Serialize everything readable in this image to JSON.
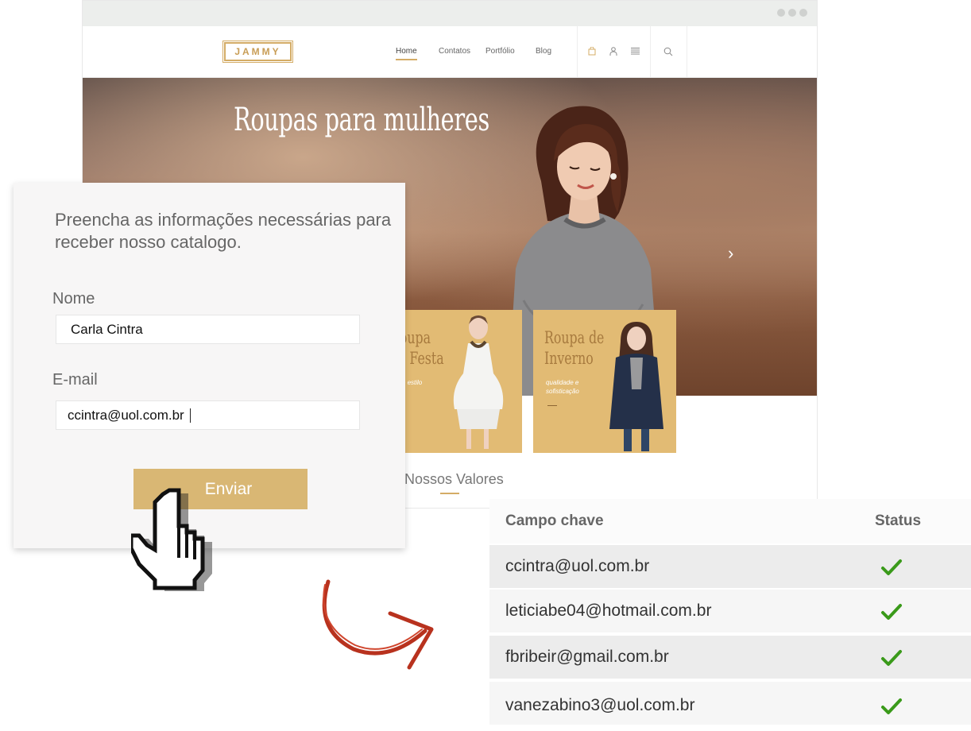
{
  "browser": {
    "logo": "JAMMY",
    "nav": [
      "Home",
      "Contatos",
      "Portfólio",
      "Blog"
    ],
    "icons": [
      "bag-icon",
      "user-icon",
      "menu-icon",
      "search-icon"
    ],
    "hero_title": "Roupas para mulheres",
    "promos": [
      {
        "title": "Roupa\nde Festa",
        "subtitle": "novo estilo\nsexy"
      },
      {
        "title": "Roupa de\nInverno",
        "subtitle": "qualidade e\nsofisticação"
      }
    ],
    "values_title": "Nossos Valores"
  },
  "form": {
    "intro": "Preencha as informações necessárias para receber nosso catalogo.",
    "name_label": "Nome",
    "name_value": "Carla Cintra",
    "email_label": "E-mail",
    "email_value": "ccintra@uol.com.br",
    "submit_label": "Enviar"
  },
  "table": {
    "headers": [
      "Campo chave",
      "Status"
    ],
    "rows": [
      {
        "email": "ccintra@uol.com.br",
        "status": "check-icon"
      },
      {
        "email": "leticiabe04@hotmail.com.br",
        "status": "check-icon"
      },
      {
        "email": "fbribeir@gmail.com.br",
        "status": "check-icon"
      },
      {
        "email": "vanezabino3@uol.com.br",
        "status": "check-icon"
      }
    ]
  },
  "colors": {
    "accent_gold": "#d9b774",
    "check_green": "#3a9a1a",
    "arrow_red": "#b8321e"
  }
}
